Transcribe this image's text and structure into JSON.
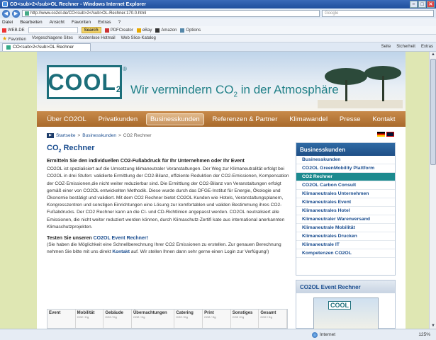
{
  "window": {
    "title": "CO<sub>2</sub>OL Rechner - Windows Internet Explorer",
    "minimize": "–",
    "maximize": "□",
    "close": "✕"
  },
  "address": {
    "url": "http://www.co2ol.de/CO<sub>2</sub>OL-Rechner.170.0.html",
    "search_placeholder": "Google"
  },
  "menu": [
    "Datei",
    "Bearbeiten",
    "Ansicht",
    "Favoriten",
    "Extras",
    "?"
  ],
  "toolbar": {
    "brand": "WEB.DE",
    "search_label": "Search",
    "items": [
      "PDFCreator",
      "eBay",
      "Amazon",
      "Options"
    ]
  },
  "favorites": {
    "label": "Favoriten",
    "items": [
      "Vorgeschlagene Sites",
      "Kostenlose Hotmail",
      "Web Slice-Katalog"
    ]
  },
  "tab": {
    "label": "CO<sub>2</sub>OL Rechner",
    "tools": [
      "Seite",
      "Sicherheit",
      "Extras"
    ]
  },
  "site": {
    "logo": "COOL",
    "logo_sub": "2",
    "reg": "®",
    "slogan_a": "Wir vermindern CO",
    "slogan_sub": "2",
    "slogan_b": " in der Atmosphäre",
    "nav": [
      "Über CO2OL",
      "Privatkunden",
      "Businesskunden",
      "Referenzen & Partner",
      "Klimawandel",
      "Presse",
      "Kontakt"
    ],
    "active_nav": "Businesskunden",
    "breadcrumb": [
      "Startseite",
      "Businesskunden",
      "CO2 Rechner"
    ],
    "heading_a": "CO",
    "heading_sub": "2",
    "heading_b": " Rechner",
    "lead": "Ermitteln Sie den individuellen CO2-Fußabdruck für Ihr Unternehmen oder Ihr Event",
    "body": "CO2OL ist spezialisiert auf die Umsetzung klimaneutraler Veranstaltungen. Der Weg zur Klimaneutralität erfolgt bei CO2OL in drei Stufen: validierte Ermittlung der CO2-Bilanz, effiziente Reduktion der CO2-Emissionen, Kompensation der COZ-Emissionen,die nicht weiter reduzierbar sind. Die Ermittlung der CO2-Bilanz von Veranstaltungen erfolgt gemäß einer von CO2OL entwickelten Methodik. Diese wurde durch das DFGE-Institut für Energie, Ökologie und Ökonomie bestätigt und validiert. Mit dem CO2 Rechner bietet CO2OL Kunden wie Hotels, Veranstaltungsplanern, Kongresszentren und sonstigen Einrichtungen eine Lösung zur komfortablen und validen Bestimmung ihres CO2-Fußabdrucks. Der CO2 Rechner kann an die CI- und CD-Richtlinien angepasst werden. CO2OL neutralisiert alle Emissionen, die nicht weiter reduziert werden können, durch Klimaschutz-Zertifi kate aus international anerkannten Klimaschutzprojekten.",
    "cta_a": "Testen Sie unseren ",
    "cta_b": "CO2OL Event Rechner!",
    "sec_a": "(Sie haben die Möglichkeit eine Schnellberechnung Ihrer CO2 Emissionen zu erstellen. Zur genauen Berechnung nehmen Sie bitte mit uns direkt ",
    "sec_link": "Kontakt",
    "sec_b": " auf. Wir stellen Ihnen dann sehr gerne einen Login zur Verfügung!)",
    "table_cols": [
      {
        "hd": "Event",
        "sub": ""
      },
      {
        "hd": "Mobilität",
        "sub": "CO2 / Kg"
      },
      {
        "hd": "Gebäude",
        "sub": "CO2 / Kg"
      },
      {
        "hd": "Übernachtungen",
        "sub": "CO2 / Kg"
      },
      {
        "hd": "Catering",
        "sub": "CO2 / Kg"
      },
      {
        "hd": "Print",
        "sub": "CO2 / Kg"
      },
      {
        "hd": "Sonstiges",
        "sub": "CO2 / Kg"
      },
      {
        "hd": "Gesamt",
        "sub": "CO2 / Kg"
      }
    ],
    "sidebar_head": "Businesskunden",
    "sidebar_items": [
      "Businesskunden",
      "CO2OL GreenMobility Plattform",
      "CO2 Rechner",
      "CO2OL Carbon Consult",
      "Klimaneutrales Unternehmen",
      "Klimaneutrales Event",
      "Klimaneutrales Hotel",
      "Klimaneutraler Warenversand",
      "Klimaneutrale Mobilität",
      "Klimaneutrales Drucken",
      "Klimaneutrale IT",
      "Kompetenzen CO2OL"
    ],
    "sidebar_active_index": 2,
    "sidebar2_head": "CO2OL Event Rechner",
    "sidebar2_logo": "COOL"
  },
  "status": {
    "zone": "Internet",
    "zoom": "125%"
  },
  "colors": {
    "brand_teal": "#1c6e7a",
    "nav_brown": "#b5763a",
    "link_blue": "#1a4d8f",
    "sidebar_head": "#2f6aa4",
    "sidebar_active": "#1c8a8f"
  }
}
